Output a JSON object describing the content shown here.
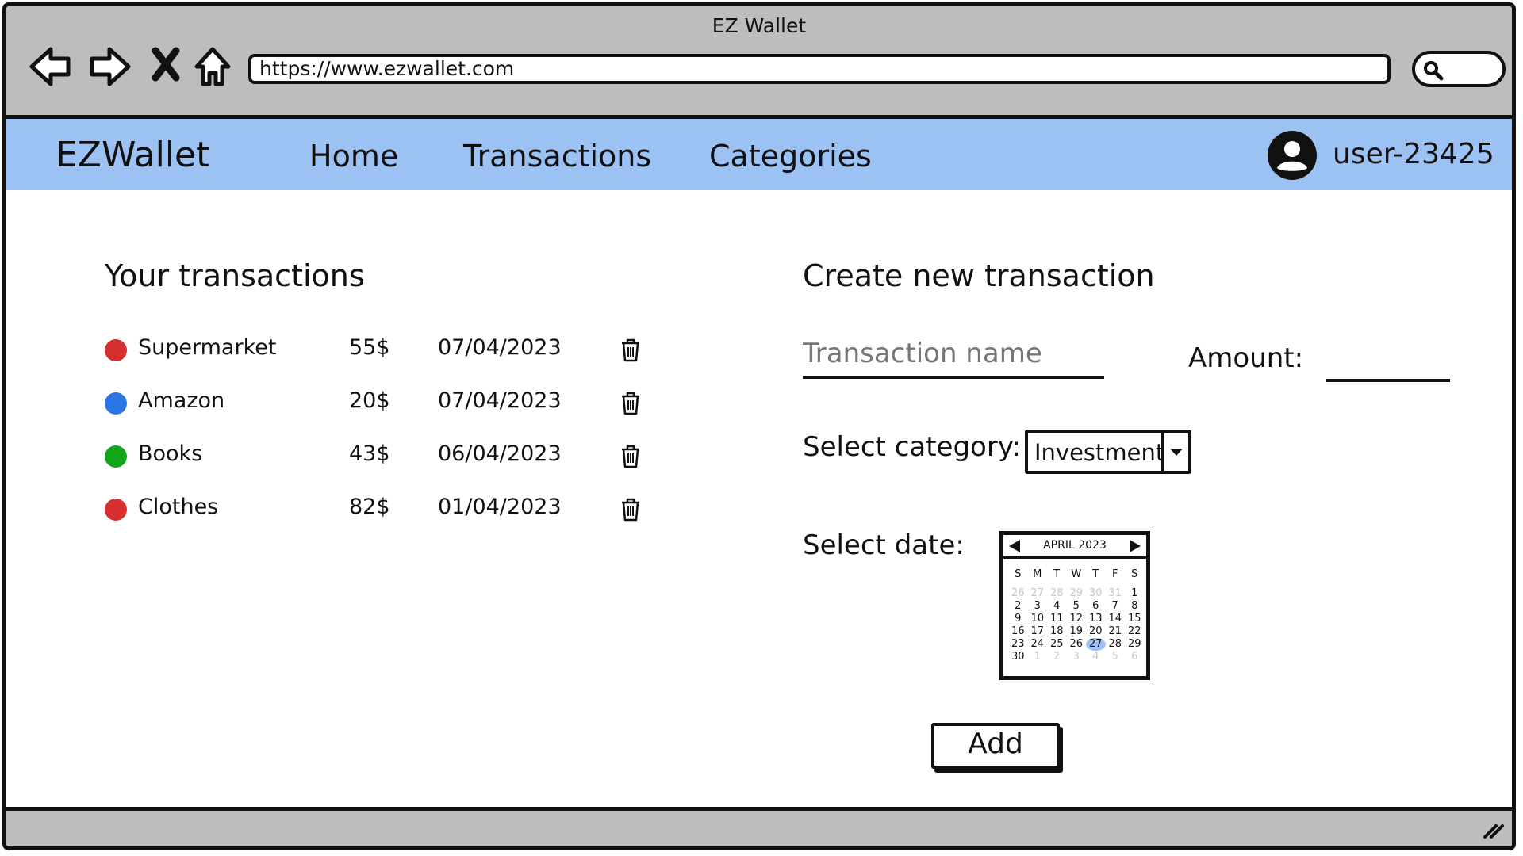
{
  "window": {
    "title": "EZ Wallet"
  },
  "browser": {
    "url": "https://www.ezwallet.com"
  },
  "app": {
    "brand": "EZWallet",
    "menu": [
      "Home",
      "Transactions",
      "Categories"
    ],
    "user": "user-23425"
  },
  "transactions": {
    "title": "Your transactions",
    "items": [
      {
        "name": "Supermarket",
        "amount": "55$",
        "date": "07/04/2023",
        "color": "#d62f2f"
      },
      {
        "name": "Amazon",
        "amount": "20$",
        "date": "07/04/2023",
        "color": "#2b74e3"
      },
      {
        "name": "Books",
        "amount": "43$",
        "date": "06/04/2023",
        "color": "#12a51a"
      },
      {
        "name": "Clothes",
        "amount": "82$",
        "date": "01/04/2023",
        "color": "#d62f2f"
      }
    ]
  },
  "create": {
    "title": "Create new transaction",
    "name_placeholder": "Transaction name",
    "amount_label": "Amount:",
    "category_label": "Select category:",
    "category_value": "Investment",
    "date_label": "Select date:",
    "add_label": "Add"
  },
  "calendar": {
    "month": "APRIL 2023",
    "weekdays": [
      "S",
      "M",
      "T",
      "W",
      "T",
      "F",
      "S"
    ],
    "weeks": [
      [
        "26",
        "27",
        "28",
        "29",
        "30",
        "31",
        "1"
      ],
      [
        "2",
        "3",
        "4",
        "5",
        "6",
        "7",
        "8"
      ],
      [
        "9",
        "10",
        "11",
        "12",
        "13",
        "14",
        "15"
      ],
      [
        "16",
        "17",
        "18",
        "19",
        "20",
        "21",
        "22"
      ],
      [
        "23",
        "24",
        "25",
        "26",
        "27",
        "28",
        "29"
      ],
      [
        "30",
        "1",
        "2",
        "3",
        "4",
        "5",
        "6"
      ]
    ],
    "selected_day": "27"
  }
}
